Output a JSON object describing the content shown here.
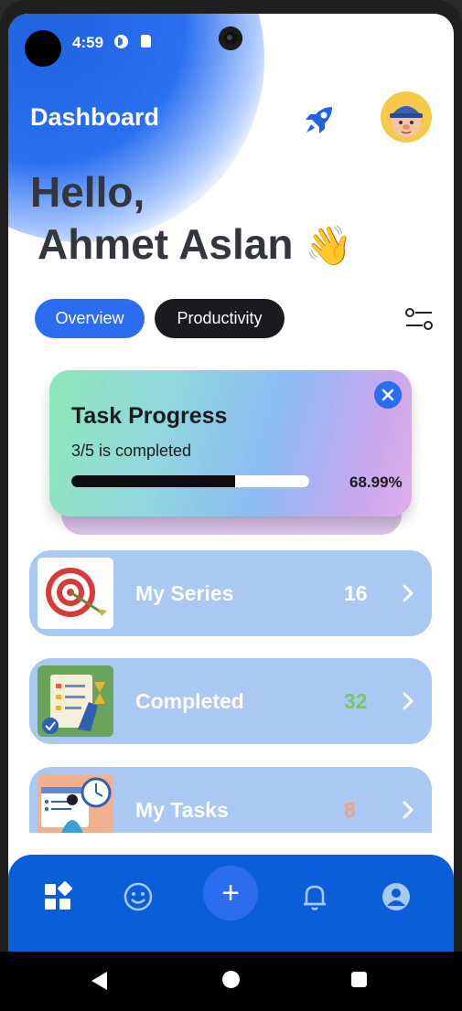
{
  "status_bar": {
    "time": "4:59"
  },
  "header": {
    "title": "Dashboard"
  },
  "greeting": {
    "hello": "Hello,",
    "name": "Ahmet Aslan",
    "emoji": "👋"
  },
  "tabs": [
    {
      "label": "Overview",
      "active": true
    },
    {
      "label": "Productivity",
      "active": false
    }
  ],
  "progress_card": {
    "title": "Task Progress",
    "subtitle": "3/5 is completed",
    "percent_text": "68.99%",
    "fill_fraction": 0.6899
  },
  "rows": [
    {
      "label": "My Series",
      "count": "16",
      "count_color": "#ffffff",
      "icon": "target-icon"
    },
    {
      "label": "Completed",
      "count": "32",
      "count_color": "#7cc46a",
      "icon": "checklist-icon"
    },
    {
      "label": "My Tasks",
      "count": "8",
      "count_color": "#f0a37e",
      "icon": "tasks-person-icon"
    }
  ],
  "bottom_nav": {
    "items": [
      "dashboard-icon",
      "smiley-icon",
      "add-icon",
      "bell-icon",
      "profile-icon"
    ],
    "add_label": "+"
  },
  "colors": {
    "accent": "#2c6cf0",
    "nav": "#0a5fd9",
    "row_bg": "#a9c9f2"
  }
}
